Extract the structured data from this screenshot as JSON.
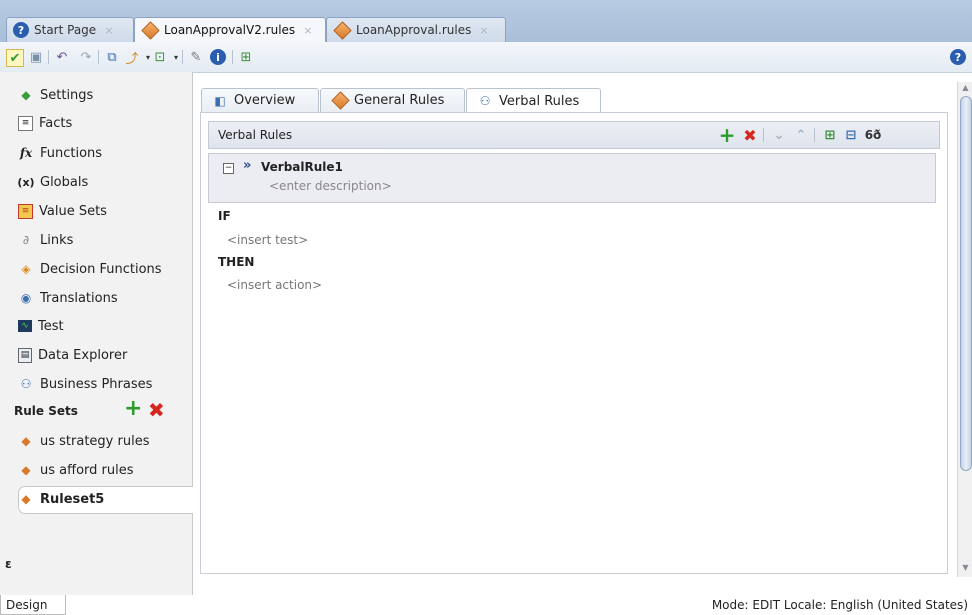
{
  "editor_tabs": [
    {
      "label": "Start Page",
      "icon": "help-icon",
      "active": false
    },
    {
      "label": "LoanApprovalV2.rules",
      "icon": "rules-diamond-icon",
      "active": true
    },
    {
      "label": "LoanApproval.rules",
      "icon": "rules-diamond-icon",
      "active": false
    }
  ],
  "tab_close_glyph": "×",
  "help_glyph": "?",
  "toolbar": {
    "icons": [
      "validate-icon",
      "preview-icon",
      "undo-icon",
      "redo-icon",
      "flow-icon",
      "dependencies-icon",
      "generate-icon",
      "tools-icon",
      "info-icon",
      "layout-icon"
    ],
    "help_glyph": "?"
  },
  "sidebar": {
    "items": [
      {
        "label": "Settings",
        "icon": "settings-icon"
      },
      {
        "label": "Facts",
        "icon": "facts-icon"
      },
      {
        "label": "Functions",
        "icon": "functions-icon",
        "icon_text": "fx"
      },
      {
        "label": "Globals",
        "icon": "globals-icon",
        "icon_text": "(x)"
      },
      {
        "label": "Value Sets",
        "icon": "value-sets-icon"
      },
      {
        "label": "Links",
        "icon": "links-icon"
      },
      {
        "label": "Decision Functions",
        "icon": "decision-functions-icon"
      },
      {
        "label": "Translations",
        "icon": "translations-icon"
      },
      {
        "label": "Test",
        "icon": "test-icon"
      },
      {
        "label": "Data Explorer",
        "icon": "data-explorer-icon"
      },
      {
        "label": "Business Phrases",
        "icon": "business-phrases-icon"
      }
    ],
    "rule_sets_header": "Rule Sets",
    "add_glyph": "+",
    "delete_glyph": "✖",
    "rule_sets": [
      {
        "label": "us strategy rules",
        "selected": false
      },
      {
        "label": "us afford rules",
        "selected": false
      },
      {
        "label": "Ruleset5",
        "selected": true
      }
    ],
    "collapse_glyph": "ɛ"
  },
  "main_tabs": [
    {
      "label": "Overview",
      "icon": "overview-icon",
      "active": false
    },
    {
      "label": "General Rules",
      "icon": "rules-diamond-icon",
      "active": false
    },
    {
      "label": "Verbal Rules",
      "icon": "verbal-rules-icon",
      "active": true
    }
  ],
  "verbal_rules": {
    "title": "Verbal Rules",
    "actions": [
      "add-icon",
      "delete-icon",
      "move-down-icon",
      "move-up-icon",
      "expand-icon",
      "collapse-icon",
      "view-icon"
    ],
    "add_glyph": "+",
    "delete_glyph": "✖",
    "view_glyph": "6ð",
    "rule": {
      "toggle_glyph": "−",
      "chevron_glyph": "»",
      "name": "VerbalRule1",
      "description_placeholder": "<enter description>"
    },
    "if_label": "IF",
    "test_placeholder": "<insert test>",
    "then_label": "THEN",
    "action_placeholder": "<insert action>"
  },
  "status": {
    "text": "Mode: EDIT   Locale: English (United States)"
  },
  "bottom_tab": "Design",
  "colors": {
    "tabstrip": "#b7cbe2",
    "accent_add": "#2e9b2e",
    "accent_delete": "#d7261e",
    "rule_header": "#dfe3ec"
  }
}
